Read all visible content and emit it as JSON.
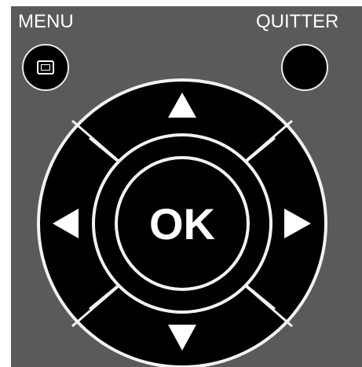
{
  "remote": {
    "menu_label": "MENU",
    "quit_label": "QUITTER",
    "ok_label": "OK",
    "icons": {
      "menu": "menu-screen-icon",
      "up": "arrow-up-icon",
      "down": "arrow-down-icon",
      "left": "arrow-left-icon",
      "right": "arrow-right-icon"
    }
  }
}
